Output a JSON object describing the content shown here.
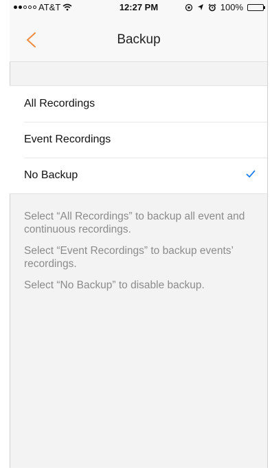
{
  "status_bar": {
    "carrier": "AT&T",
    "time": "12:27 PM",
    "battery": "100%",
    "signal_icon": "signal-dots-icon",
    "wifi_icon": "wifi-icon",
    "location_icon": "location-arrow-icon",
    "alarm_icon": "alarm-clock-icon"
  },
  "nav": {
    "title": "Backup",
    "back_icon": "chevron-left-icon"
  },
  "options": [
    {
      "label": "All Recordings",
      "selected": false
    },
    {
      "label": "Event Recordings",
      "selected": false
    },
    {
      "label": "No Backup",
      "selected": true
    }
  ],
  "notes": [
    "Select “All Recordings” to backup all event and continuous recordings.",
    "Select “Event Recordings” to backup events’ recordings.",
    "Select “No Backup” to disable backup."
  ],
  "colors": {
    "accent_orange": "#f08a3e",
    "check_blue": "#1a7ef0",
    "note_gray": "#8b8b8b"
  }
}
